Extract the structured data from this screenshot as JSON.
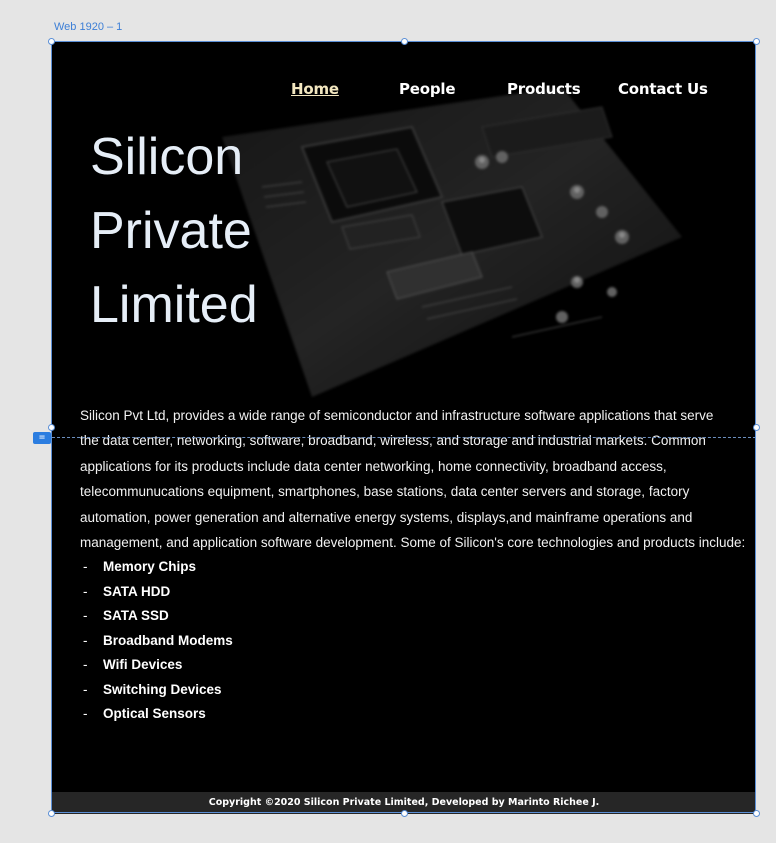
{
  "artboard": {
    "label": "Web 1920 – 1"
  },
  "nav": {
    "items": [
      {
        "label": "Home",
        "active": true
      },
      {
        "label": "People",
        "active": false
      },
      {
        "label": "Products",
        "active": false
      },
      {
        "label": "Contact Us",
        "active": false
      }
    ]
  },
  "hero": {
    "title_lines": [
      "Silicon",
      "Private",
      "Limited"
    ]
  },
  "intro": {
    "lines": [
      "Silicon Pvt Ltd, provides a wide range of semiconductor and infrastructure software applications that serve",
      "the data center, networking, software, broadband, wireless, and storage and industrial markets. Common",
      "applications for its products include data center networking, home connectivity, broadband access,",
      "telecommunucations equipment, smartphones, base stations, data center servers and storage, factory",
      "automation, power generation and alternative energy systems, displays,and mainframe operations and",
      "management, and application software development. Some of Silicon's core technologies and products include:"
    ]
  },
  "features": {
    "dash": "-",
    "items": [
      "Memory Chips",
      "SATA HDD",
      "SATA SSD",
      "Broadband Modems",
      "Wifi Devices",
      "Switching Devices",
      "Optical Sensors"
    ]
  },
  "guide": {
    "badge": "="
  },
  "footer": {
    "copyright": "Copyright ©2020 Silicon Private Limited, Developed by Marinto Richee J."
  },
  "colors": {
    "background": "#000000",
    "active_nav": "#f3e7c0",
    "footer_bg": "#262626",
    "selection": "#5b8fd6"
  }
}
